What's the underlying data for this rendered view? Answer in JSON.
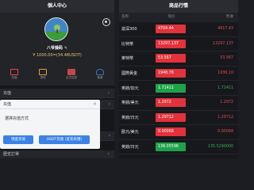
{
  "left": {
    "title": "個人中心",
    "username": "八爷操码",
    "balance": "¥ 1000.00=(34.48USDT)",
    "quick": [
      {
        "label": "充值",
        "icon": "recharge-icon",
        "color": "#d94a4a"
      },
      {
        "label": "提现",
        "icon": "withdraw-icon",
        "color": "#d9a23a"
      },
      {
        "label": "会员信息",
        "icon": "member-icon",
        "color": "#c24848"
      },
      {
        "label": "客服",
        "icon": "service-icon",
        "color": "#3f6fd1"
      }
    ],
    "menu_top": "充值",
    "menu_mid": "",
    "history": "歷史訂單"
  },
  "modal": {
    "title": "充值",
    "subtitle": "選擇充值方式",
    "button_a": "現金充值",
    "button_b": "USDT充值 (首充有禮)"
  },
  "right": {
    "title": "商品行情",
    "columns": [
      "名称",
      "现价",
      "昨收"
    ],
    "rows": [
      {
        "name": "滬深300",
        "price": "4704.44",
        "prev": "4617.43",
        "trend": "down"
      },
      {
        "name": "比特幣",
        "price": "13297.137",
        "prev": "13297.137",
        "trend": "down"
      },
      {
        "name": "萊特幣",
        "price": "53.567",
        "prev": "53.567",
        "trend": "down"
      },
      {
        "name": "國際黃金",
        "price": "1948.78",
        "prev": "1936.10",
        "trend": "down"
      },
      {
        "name": "英鎊/加元",
        "price": "1.71411",
        "prev": "1.71411",
        "trend": "up"
      },
      {
        "name": "英鎊/美元",
        "price": "1.2972",
        "prev": "1.2972",
        "trend": "down"
      },
      {
        "name": "英鎊/日元",
        "price": "1.29712",
        "prev": "1.29712",
        "trend": "down"
      },
      {
        "name": "歐元/美元",
        "price": "0.90068",
        "prev": "0.90068",
        "trend": "down"
      },
      {
        "name": "英鎊/日元",
        "price": "136.05596",
        "prev": "135.5290000",
        "trend": "up"
      }
    ]
  }
}
